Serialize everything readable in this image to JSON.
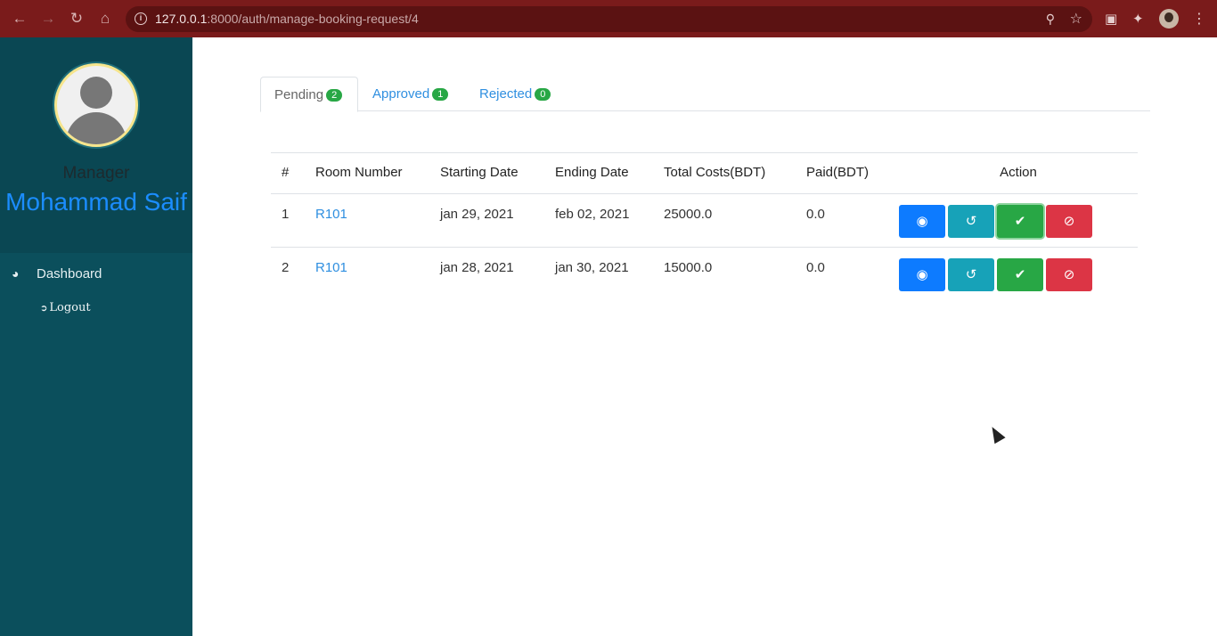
{
  "browser": {
    "url_host": "127.0.0.1",
    "url_rest": ":8000/auth/manage-booking-request/4"
  },
  "sidebar": {
    "role": "Manager",
    "user_name": "Mohammad Saif",
    "items": [
      {
        "label": "Dashboard",
        "icon": "tachometer-icon"
      },
      {
        "label": "Logout",
        "icon": "sign-out-icon"
      }
    ]
  },
  "tabs": [
    {
      "label": "Pending",
      "count": "2",
      "active": true
    },
    {
      "label": "Approved",
      "count": "1",
      "active": false
    },
    {
      "label": "Rejected",
      "count": "0",
      "active": false
    }
  ],
  "table": {
    "headers": [
      "#",
      "Room Number",
      "Starting Date",
      "Ending Date",
      "Total Costs(BDT)",
      "Paid(BDT)",
      "Action"
    ],
    "rows": [
      {
        "num": "1",
        "room": "R101",
        "start": "jan 29, 2021",
        "end": "feb 02, 2021",
        "total": "25000.0",
        "paid": "0.0"
      },
      {
        "num": "2",
        "room": "R101",
        "start": "jan 28, 2021",
        "end": "jan 30, 2021",
        "total": "15000.0",
        "paid": "0.0"
      }
    ],
    "actions": [
      "eye-icon",
      "history-icon",
      "check-icon",
      "ban-icon"
    ]
  },
  "colors": {
    "sidebar_bg": "#0b4f5c",
    "accent_blue": "#1b8dff",
    "badge_green": "#28a745",
    "view": "#0d7bff",
    "history": "#17a2b8",
    "approve": "#28a745",
    "reject": "#dc3545"
  }
}
